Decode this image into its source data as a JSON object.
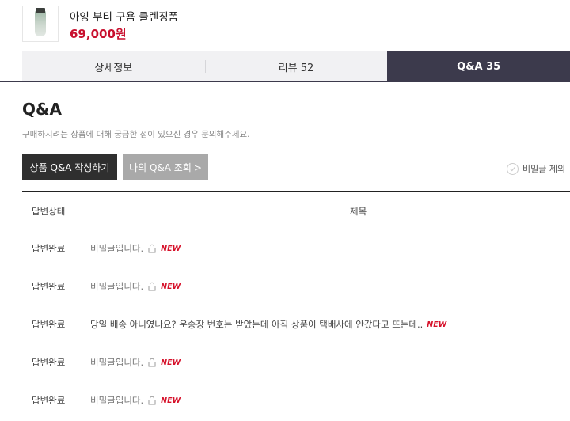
{
  "product": {
    "name": "아잉 부티 구욤 클렌징폼",
    "price": "69,000원"
  },
  "tabs": [
    {
      "label": "상세정보",
      "active": false
    },
    {
      "label": "리뷰 52",
      "active": false
    },
    {
      "label": "Q&A 35",
      "active": true
    }
  ],
  "qa": {
    "title": "Q&A",
    "description": "구매하시려는 상품에 대해 궁금한 점이 있으신 경우 문의해주세요.",
    "write_button": "상품 Q&A 작성하기",
    "my_button": "나의 Q&A 조회",
    "my_button_arrow": ">",
    "filter_label": "비밀글 제외"
  },
  "table": {
    "headers": {
      "status": "답변상태",
      "title": "제목"
    },
    "rows": [
      {
        "status": "답변완료",
        "title": "비밀글입니다.",
        "secret": true,
        "badge": "NEW"
      },
      {
        "status": "답변완료",
        "title": "비밀글입니다.",
        "secret": true,
        "badge": "NEW"
      },
      {
        "status": "답변완료",
        "title": "당일 배송 아니였나요? 운송장 번호는 받았는데 아직 상품이 택배사에 안갔다고 뜨는데..",
        "secret": false,
        "badge": "NEW"
      },
      {
        "status": "답변완료",
        "title": "비밀글입니다.",
        "secret": true,
        "badge": "NEW"
      },
      {
        "status": "답변완료",
        "title": "비밀글입니다.",
        "secret": true,
        "badge": "NEW"
      }
    ]
  },
  "colors": {
    "accent_price": "#c8102e",
    "tab_active_bg": "#3c3a4c",
    "new_badge": "#d6112a"
  }
}
